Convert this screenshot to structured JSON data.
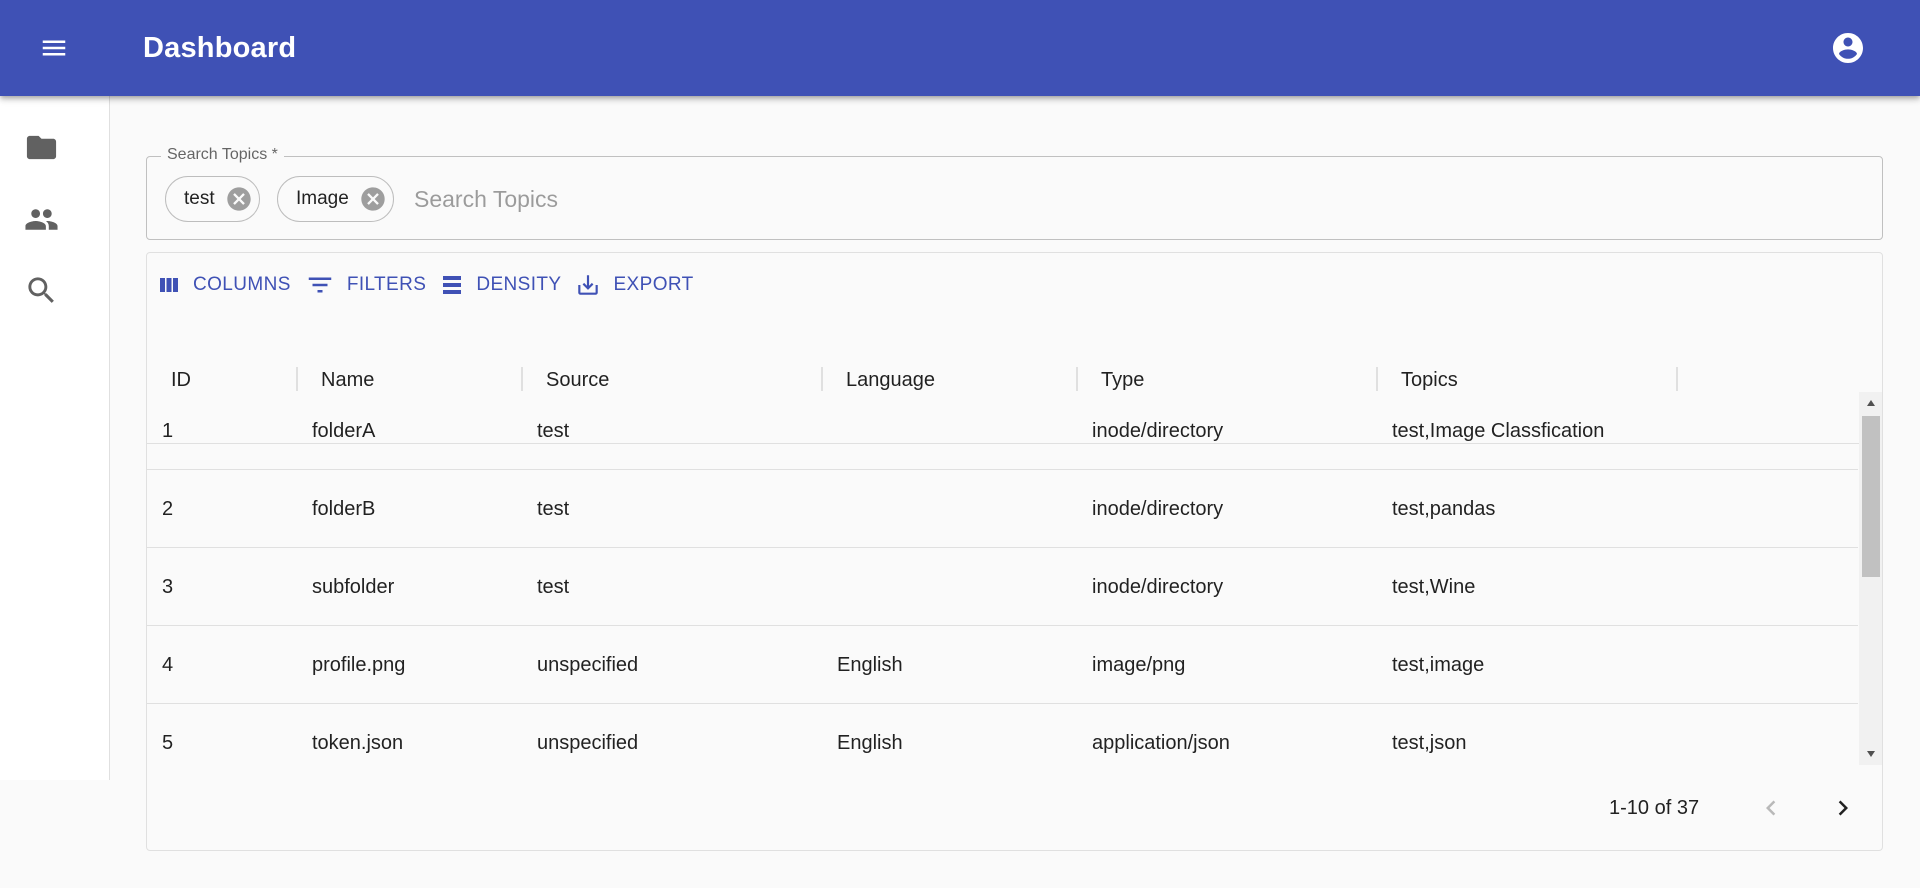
{
  "appbar": {
    "title": "Dashboard",
    "menu_icon": "menu-icon",
    "account_icon": "account-circle-icon",
    "color": "#3f51b5"
  },
  "drawer": {
    "items": [
      {
        "icon": "folder-icon"
      },
      {
        "icon": "people-icon"
      },
      {
        "icon": "search-icon"
      }
    ]
  },
  "search": {
    "label": "Search Topics *",
    "placeholder": "Search Topics",
    "value": "",
    "chips": [
      {
        "label": "test"
      },
      {
        "label": "Image"
      }
    ]
  },
  "toolbar": {
    "columns_label": "COLUMNS",
    "filters_label": "FILTERS",
    "density_label": "DENSITY",
    "export_label": "EXPORT"
  },
  "table": {
    "columns": [
      "ID",
      "Name",
      "Source",
      "Language",
      "Type",
      "Topics"
    ],
    "rows": [
      {
        "id": "1",
        "name": "folderA",
        "source": "test",
        "language": "",
        "type": "inode/directory",
        "topics": "test,Image Classfication"
      },
      {
        "id": "2",
        "name": "folderB",
        "source": "test",
        "language": "",
        "type": "inode/directory",
        "topics": "test,pandas"
      },
      {
        "id": "3",
        "name": "subfolder",
        "source": "test",
        "language": "",
        "type": "inode/directory",
        "topics": "test,Wine"
      },
      {
        "id": "4",
        "name": "profile.png",
        "source": "unspecified",
        "language": "English",
        "type": "image/png",
        "topics": "test,image"
      },
      {
        "id": "5",
        "name": "token.json",
        "source": "unspecified",
        "language": "English",
        "type": "application/json",
        "topics": "test,json"
      }
    ]
  },
  "pagination": {
    "info": "1-10 of 37"
  }
}
